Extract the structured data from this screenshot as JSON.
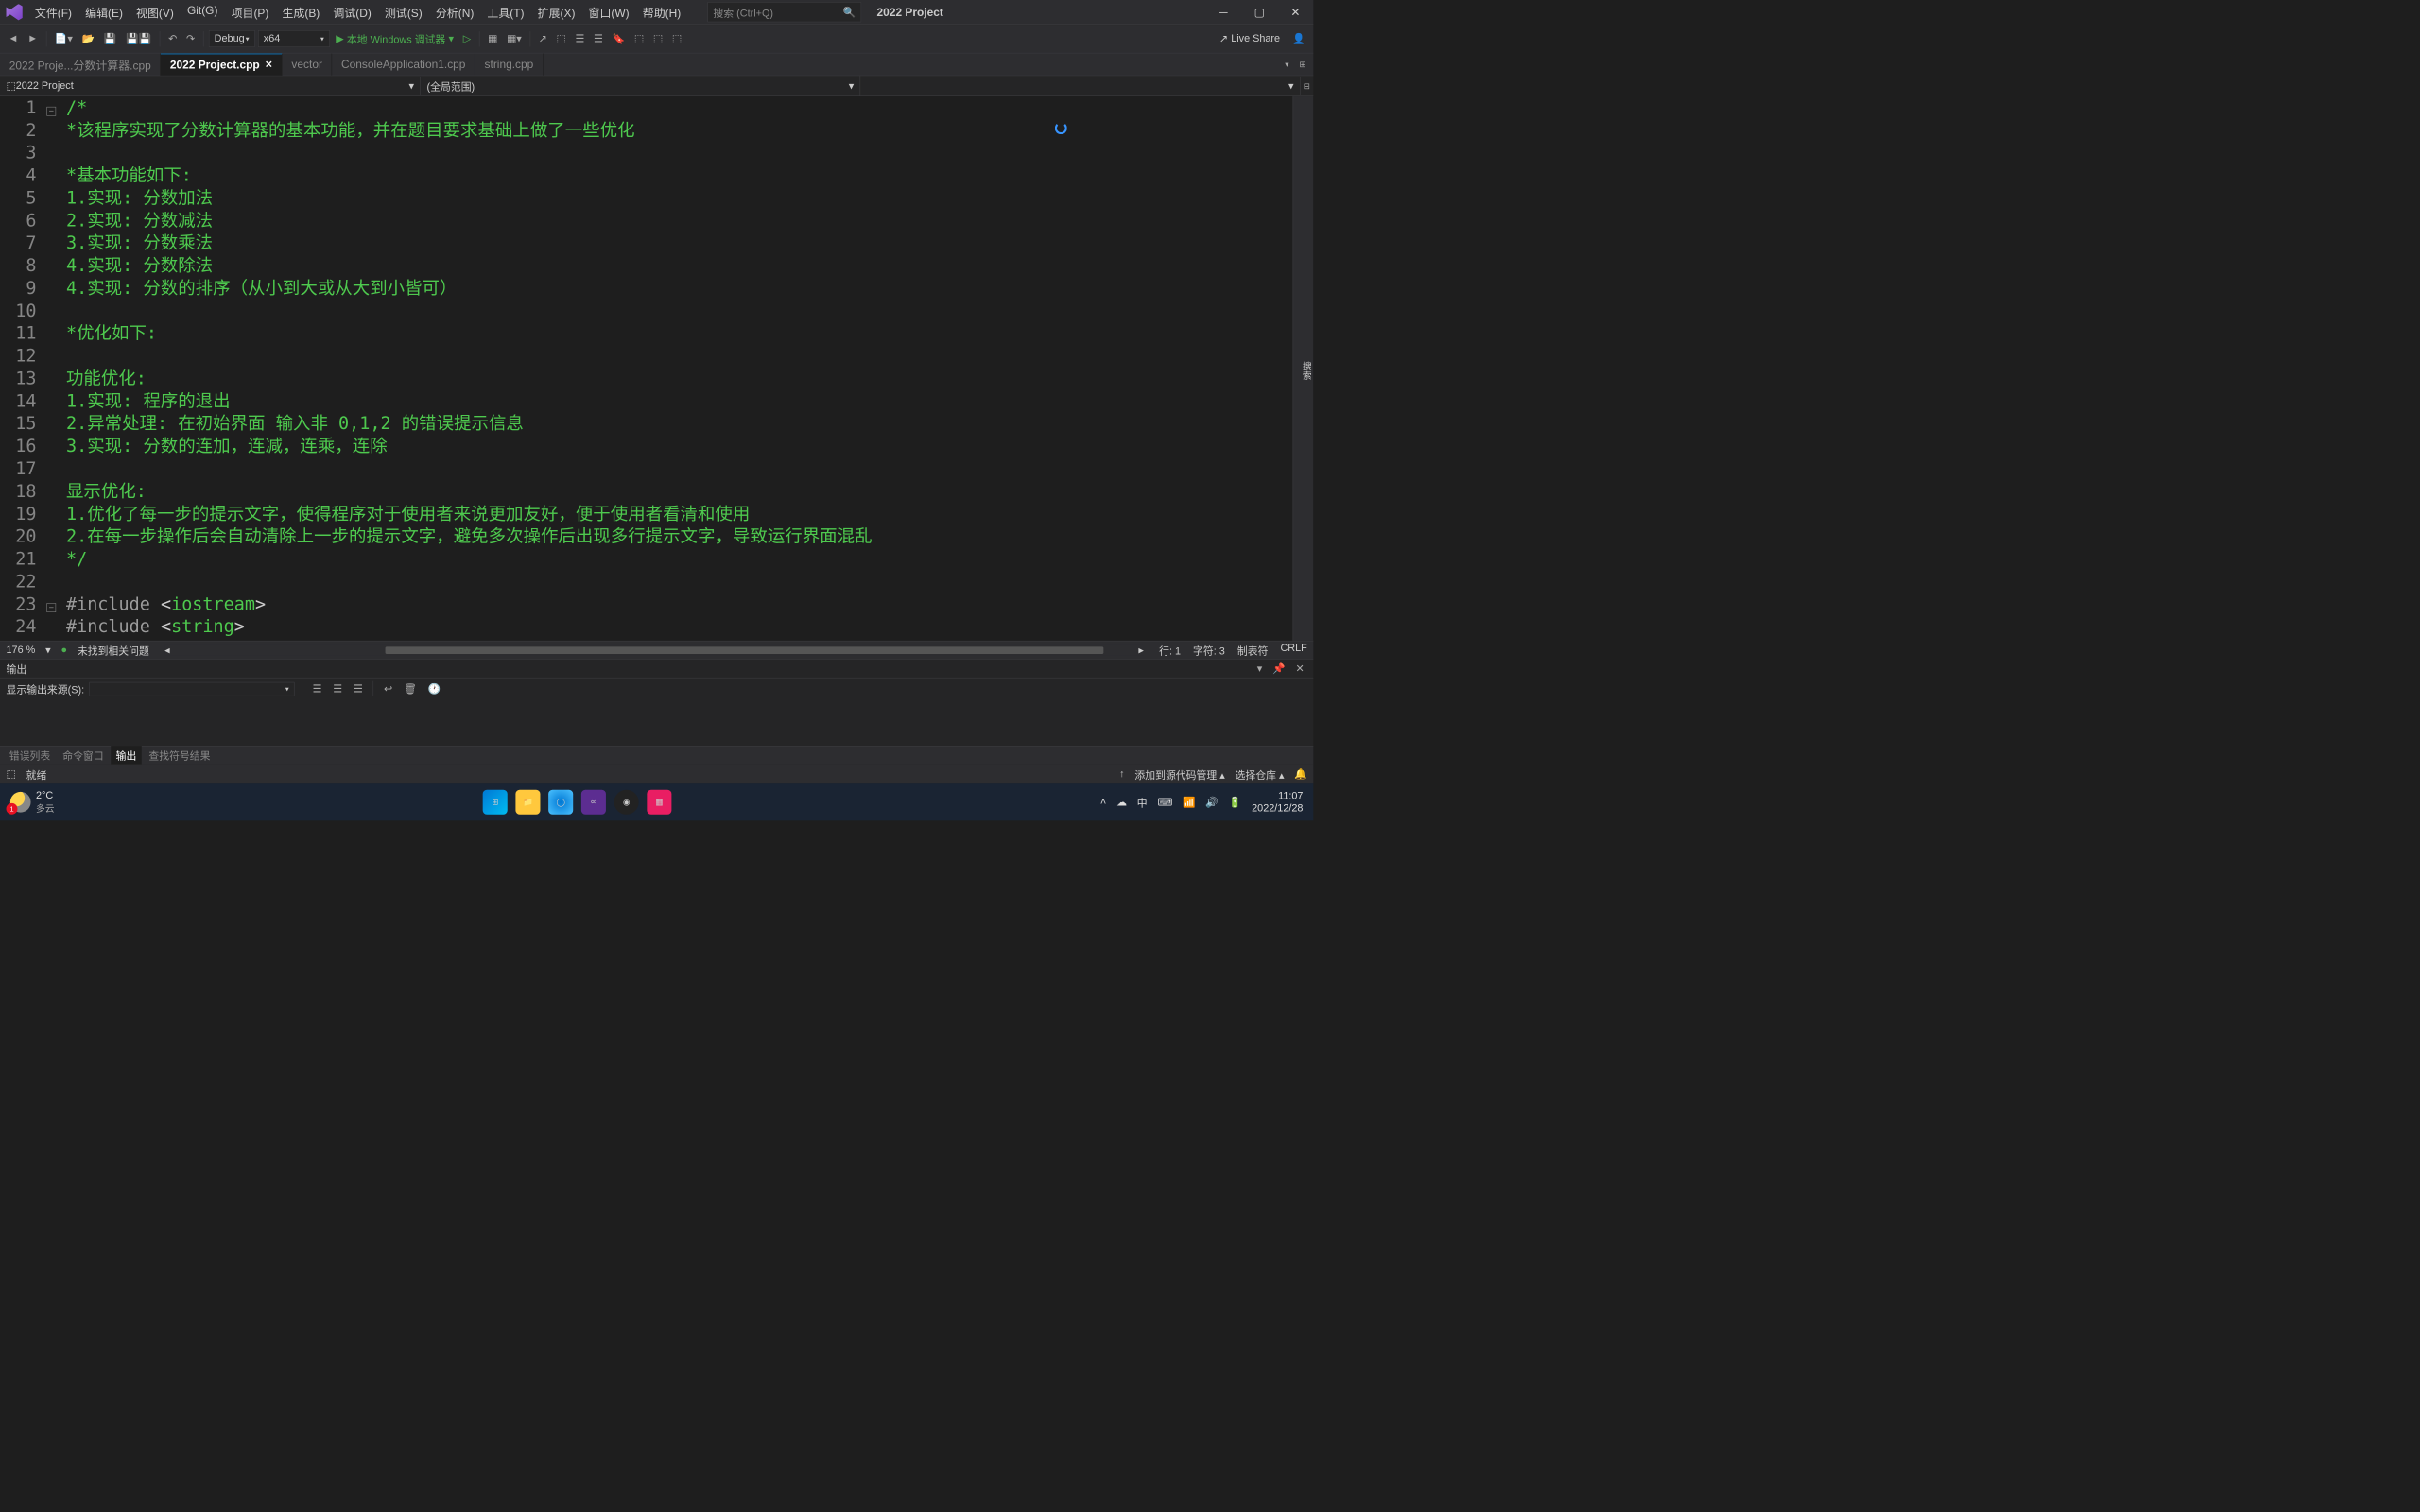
{
  "menu": [
    "文件(F)",
    "编辑(E)",
    "视图(V)",
    "Git(G)",
    "项目(P)",
    "生成(B)",
    "调试(D)",
    "测试(S)",
    "分析(N)",
    "工具(T)",
    "扩展(X)",
    "窗口(W)",
    "帮助(H)"
  ],
  "search_placeholder": "搜索 (Ctrl+Q)",
  "solution_name": "2022 Project",
  "toolbar": {
    "config": "Debug",
    "platform": "x64",
    "debugger": "本地 Windows 调试器",
    "live_share": "Live Share"
  },
  "tabs": [
    {
      "label": "2022 Proje...分数计算器.cpp",
      "active": false
    },
    {
      "label": "2022 Project.cpp",
      "active": true
    },
    {
      "label": "vector",
      "active": false
    },
    {
      "label": "ConsoleApplication1.cpp",
      "active": false
    },
    {
      "label": "string.cpp",
      "active": false
    }
  ],
  "nav": {
    "scope": "2022 Project",
    "member": "(全局范围)"
  },
  "code_lines": [
    {
      "n": 1,
      "fold": "-",
      "text": "/*",
      "cls": "comment"
    },
    {
      "n": 2,
      "text": "*该程序实现了分数计算器的基本功能，并在题目要求基础上做了一些优化",
      "cls": "comment"
    },
    {
      "n": 3,
      "text": "",
      "cls": "comment"
    },
    {
      "n": 4,
      "text": "*基本功能如下:",
      "cls": "comment"
    },
    {
      "n": 5,
      "text": "1.实现: 分数加法",
      "cls": "comment"
    },
    {
      "n": 6,
      "text": "2.实现: 分数减法",
      "cls": "comment"
    },
    {
      "n": 7,
      "text": "3.实现: 分数乘法",
      "cls": "comment"
    },
    {
      "n": 8,
      "text": "4.实现: 分数除法",
      "cls": "comment"
    },
    {
      "n": 9,
      "text": "4.实现: 分数的排序（从小到大或从大到小皆可）",
      "cls": "comment"
    },
    {
      "n": 10,
      "text": "",
      "cls": "comment"
    },
    {
      "n": 11,
      "text": "*优化如下:",
      "cls": "comment"
    },
    {
      "n": 12,
      "text": "",
      "cls": "comment"
    },
    {
      "n": 13,
      "text": "功能优化:",
      "cls": "comment"
    },
    {
      "n": 14,
      "text": "1.实现: 程序的退出",
      "cls": "comment"
    },
    {
      "n": 15,
      "text": "2.异常处理: 在初始界面 输入非 0,1,2 的错误提示信息",
      "cls": "comment"
    },
    {
      "n": 16,
      "text": "3.实现: 分数的连加，连减，连乘，连除",
      "cls": "comment"
    },
    {
      "n": 17,
      "text": "",
      "cls": "comment"
    },
    {
      "n": 18,
      "text": "显示优化:",
      "cls": "comment"
    },
    {
      "n": 19,
      "text": "1.优化了每一步的提示文字，使得程序对于使用者来说更加友好，便于使用者看清和使用",
      "cls": "comment"
    },
    {
      "n": 20,
      "text": "2.在每一步操作后会自动清除上一步的提示文字，避免多次操作后出现多行提示文字，导致运行界面混乱",
      "cls": "comment"
    },
    {
      "n": 21,
      "text": "*/",
      "cls": "comment"
    },
    {
      "n": 22,
      "text": "",
      "cls": "punct"
    },
    {
      "n": 23,
      "fold": "-",
      "text": "#include <iostream>",
      "cls": "punct"
    },
    {
      "n": 24,
      "text": "#include <string>",
      "cls": "punct"
    }
  ],
  "editor_status": {
    "zoom": "176 %",
    "issues": "未找到相关问题",
    "line": "行: 1",
    "char": "字符: 3",
    "tabs": "制表符",
    "eol": "CRLF"
  },
  "output": {
    "title": "输出",
    "source_label": "显示输出来源(S):"
  },
  "bottom_tabs": [
    "错误列表",
    "命令窗口",
    "输出",
    "查找符号结果"
  ],
  "bottom_active": 2,
  "status": {
    "ready": "就绪",
    "source_control": "添加到源代码管理",
    "repo": "选择仓库"
  },
  "side_label": "搜索",
  "weather": {
    "temp": "2°C",
    "desc": "多云",
    "badge": "1"
  },
  "tray": {
    "time": "11:07",
    "date": "2022/12/28"
  }
}
